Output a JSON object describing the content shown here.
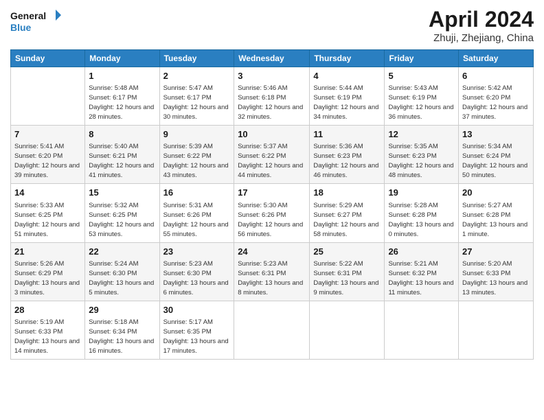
{
  "header": {
    "logo_line1": "General",
    "logo_line2": "Blue",
    "month_title": "April 2024",
    "subtitle": "Zhuji, Zhejiang, China"
  },
  "days_of_week": [
    "Sunday",
    "Monday",
    "Tuesday",
    "Wednesday",
    "Thursday",
    "Friday",
    "Saturday"
  ],
  "weeks": [
    [
      {
        "num": "",
        "sunrise": "",
        "sunset": "",
        "daylight": ""
      },
      {
        "num": "1",
        "sunrise": "Sunrise: 5:48 AM",
        "sunset": "Sunset: 6:17 PM",
        "daylight": "Daylight: 12 hours and 28 minutes."
      },
      {
        "num": "2",
        "sunrise": "Sunrise: 5:47 AM",
        "sunset": "Sunset: 6:17 PM",
        "daylight": "Daylight: 12 hours and 30 minutes."
      },
      {
        "num": "3",
        "sunrise": "Sunrise: 5:46 AM",
        "sunset": "Sunset: 6:18 PM",
        "daylight": "Daylight: 12 hours and 32 minutes."
      },
      {
        "num": "4",
        "sunrise": "Sunrise: 5:44 AM",
        "sunset": "Sunset: 6:19 PM",
        "daylight": "Daylight: 12 hours and 34 minutes."
      },
      {
        "num": "5",
        "sunrise": "Sunrise: 5:43 AM",
        "sunset": "Sunset: 6:19 PM",
        "daylight": "Daylight: 12 hours and 36 minutes."
      },
      {
        "num": "6",
        "sunrise": "Sunrise: 5:42 AM",
        "sunset": "Sunset: 6:20 PM",
        "daylight": "Daylight: 12 hours and 37 minutes."
      }
    ],
    [
      {
        "num": "7",
        "sunrise": "Sunrise: 5:41 AM",
        "sunset": "Sunset: 6:20 PM",
        "daylight": "Daylight: 12 hours and 39 minutes."
      },
      {
        "num": "8",
        "sunrise": "Sunrise: 5:40 AM",
        "sunset": "Sunset: 6:21 PM",
        "daylight": "Daylight: 12 hours and 41 minutes."
      },
      {
        "num": "9",
        "sunrise": "Sunrise: 5:39 AM",
        "sunset": "Sunset: 6:22 PM",
        "daylight": "Daylight: 12 hours and 43 minutes."
      },
      {
        "num": "10",
        "sunrise": "Sunrise: 5:37 AM",
        "sunset": "Sunset: 6:22 PM",
        "daylight": "Daylight: 12 hours and 44 minutes."
      },
      {
        "num": "11",
        "sunrise": "Sunrise: 5:36 AM",
        "sunset": "Sunset: 6:23 PM",
        "daylight": "Daylight: 12 hours and 46 minutes."
      },
      {
        "num": "12",
        "sunrise": "Sunrise: 5:35 AM",
        "sunset": "Sunset: 6:23 PM",
        "daylight": "Daylight: 12 hours and 48 minutes."
      },
      {
        "num": "13",
        "sunrise": "Sunrise: 5:34 AM",
        "sunset": "Sunset: 6:24 PM",
        "daylight": "Daylight: 12 hours and 50 minutes."
      }
    ],
    [
      {
        "num": "14",
        "sunrise": "Sunrise: 5:33 AM",
        "sunset": "Sunset: 6:25 PM",
        "daylight": "Daylight: 12 hours and 51 minutes."
      },
      {
        "num": "15",
        "sunrise": "Sunrise: 5:32 AM",
        "sunset": "Sunset: 6:25 PM",
        "daylight": "Daylight: 12 hours and 53 minutes."
      },
      {
        "num": "16",
        "sunrise": "Sunrise: 5:31 AM",
        "sunset": "Sunset: 6:26 PM",
        "daylight": "Daylight: 12 hours and 55 minutes."
      },
      {
        "num": "17",
        "sunrise": "Sunrise: 5:30 AM",
        "sunset": "Sunset: 6:26 PM",
        "daylight": "Daylight: 12 hours and 56 minutes."
      },
      {
        "num": "18",
        "sunrise": "Sunrise: 5:29 AM",
        "sunset": "Sunset: 6:27 PM",
        "daylight": "Daylight: 12 hours and 58 minutes."
      },
      {
        "num": "19",
        "sunrise": "Sunrise: 5:28 AM",
        "sunset": "Sunset: 6:28 PM",
        "daylight": "Daylight: 13 hours and 0 minutes."
      },
      {
        "num": "20",
        "sunrise": "Sunrise: 5:27 AM",
        "sunset": "Sunset: 6:28 PM",
        "daylight": "Daylight: 13 hours and 1 minute."
      }
    ],
    [
      {
        "num": "21",
        "sunrise": "Sunrise: 5:26 AM",
        "sunset": "Sunset: 6:29 PM",
        "daylight": "Daylight: 13 hours and 3 minutes."
      },
      {
        "num": "22",
        "sunrise": "Sunrise: 5:24 AM",
        "sunset": "Sunset: 6:30 PM",
        "daylight": "Daylight: 13 hours and 5 minutes."
      },
      {
        "num": "23",
        "sunrise": "Sunrise: 5:23 AM",
        "sunset": "Sunset: 6:30 PM",
        "daylight": "Daylight: 13 hours and 6 minutes."
      },
      {
        "num": "24",
        "sunrise": "Sunrise: 5:23 AM",
        "sunset": "Sunset: 6:31 PM",
        "daylight": "Daylight: 13 hours and 8 minutes."
      },
      {
        "num": "25",
        "sunrise": "Sunrise: 5:22 AM",
        "sunset": "Sunset: 6:31 PM",
        "daylight": "Daylight: 13 hours and 9 minutes."
      },
      {
        "num": "26",
        "sunrise": "Sunrise: 5:21 AM",
        "sunset": "Sunset: 6:32 PM",
        "daylight": "Daylight: 13 hours and 11 minutes."
      },
      {
        "num": "27",
        "sunrise": "Sunrise: 5:20 AM",
        "sunset": "Sunset: 6:33 PM",
        "daylight": "Daylight: 13 hours and 13 minutes."
      }
    ],
    [
      {
        "num": "28",
        "sunrise": "Sunrise: 5:19 AM",
        "sunset": "Sunset: 6:33 PM",
        "daylight": "Daylight: 13 hours and 14 minutes."
      },
      {
        "num": "29",
        "sunrise": "Sunrise: 5:18 AM",
        "sunset": "Sunset: 6:34 PM",
        "daylight": "Daylight: 13 hours and 16 minutes."
      },
      {
        "num": "30",
        "sunrise": "Sunrise: 5:17 AM",
        "sunset": "Sunset: 6:35 PM",
        "daylight": "Daylight: 13 hours and 17 minutes."
      },
      {
        "num": "",
        "sunrise": "",
        "sunset": "",
        "daylight": ""
      },
      {
        "num": "",
        "sunrise": "",
        "sunset": "",
        "daylight": ""
      },
      {
        "num": "",
        "sunrise": "",
        "sunset": "",
        "daylight": ""
      },
      {
        "num": "",
        "sunrise": "",
        "sunset": "",
        "daylight": ""
      }
    ]
  ]
}
